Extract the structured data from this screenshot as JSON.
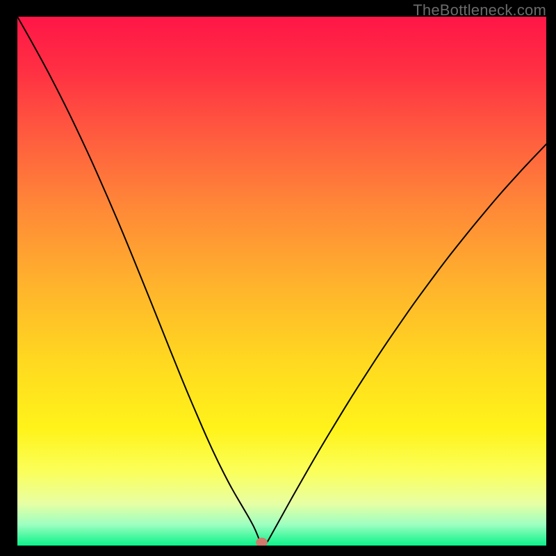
{
  "watermark": "TheBottleneck.com",
  "chart_data": {
    "type": "line",
    "title": "",
    "xlabel": "",
    "ylabel": "",
    "xlim": [
      0,
      100
    ],
    "ylim": [
      0,
      100
    ],
    "grid": false,
    "legend": false,
    "background_gradient": {
      "stops": [
        {
          "offset": 0.0,
          "color": "#ff1647"
        },
        {
          "offset": 0.1,
          "color": "#ff2f43"
        },
        {
          "offset": 0.22,
          "color": "#ff5a3f"
        },
        {
          "offset": 0.35,
          "color": "#ff8538"
        },
        {
          "offset": 0.5,
          "color": "#ffb12d"
        },
        {
          "offset": 0.65,
          "color": "#ffd820"
        },
        {
          "offset": 0.78,
          "color": "#fff31a"
        },
        {
          "offset": 0.86,
          "color": "#fbff5a"
        },
        {
          "offset": 0.92,
          "color": "#e8ffa3"
        },
        {
          "offset": 0.96,
          "color": "#9effc1"
        },
        {
          "offset": 1.0,
          "color": "#0bf28a"
        }
      ]
    },
    "series": [
      {
        "name": "bottleneck-curve",
        "color": "#000000",
        "width": 2,
        "x": [
          0.0,
          2.0,
          4.0,
          6.0,
          8.0,
          10.0,
          12.0,
          14.0,
          16.0,
          18.0,
          20.0,
          22.0,
          24.0,
          26.0,
          28.0,
          30.0,
          32.0,
          34.0,
          36.0,
          38.0,
          40.0,
          41.0,
          42.0,
          43.0,
          44.0,
          45.0,
          46.0,
          47.0,
          48.0,
          50.0,
          52.0,
          54.0,
          56.0,
          58.0,
          60.0,
          62.0,
          64.0,
          66.0,
          68.0,
          70.0,
          72.0,
          74.0,
          76.0,
          78.0,
          80.0,
          82.0,
          84.0,
          86.0,
          88.0,
          90.0,
          92.0,
          94.0,
          96.0,
          98.0,
          100.0
        ],
        "y": [
          100.0,
          96.5,
          92.9,
          89.2,
          85.3,
          81.3,
          77.1,
          72.8,
          68.3,
          63.7,
          59.0,
          54.1,
          49.2,
          44.2,
          39.2,
          34.2,
          29.3,
          24.6,
          20.0,
          15.7,
          11.8,
          10.0,
          8.3,
          6.6,
          4.9,
          3.0,
          0.4,
          0.2,
          2.0,
          5.6,
          9.2,
          12.7,
          16.2,
          19.6,
          22.9,
          26.2,
          29.4,
          32.5,
          35.6,
          38.6,
          41.5,
          44.4,
          47.2,
          49.9,
          52.6,
          55.2,
          57.7,
          60.2,
          62.6,
          65.0,
          67.3,
          69.5,
          71.7,
          73.8,
          75.9
        ]
      }
    ],
    "marker": {
      "name": "optimal-point",
      "x": 46.2,
      "y": 0.6,
      "rx": 1.1,
      "ry": 0.9,
      "color": "#cf7a6d"
    }
  }
}
